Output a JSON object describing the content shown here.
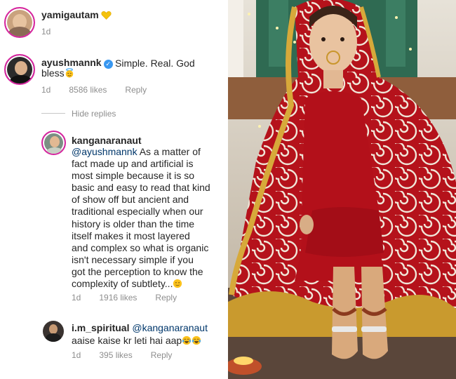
{
  "comments": [
    {
      "username": "yamigautam",
      "text": "",
      "time": "1d",
      "emoji": "yellow-heart"
    },
    {
      "username": "ayushmannk",
      "verified": true,
      "text": "Simple. Real. God",
      "text_line2": "bless",
      "time": "1d",
      "likes": "8586 likes",
      "reply": "Reply",
      "hide_replies": "Hide replies",
      "emoji": "smiling-face-with-halo"
    },
    {
      "username": "kanganaranaut",
      "mention": "@ayushmannk",
      "lines": [
        "As a matter of",
        "fact made up and artificial is",
        "most simple because it is so",
        "basic and easy to read that kind",
        "of show off but ancient and",
        "traditional especially when our",
        "history is older than the time",
        "itself makes it most layered",
        "and complex so what is organic",
        "isn't necessary simple if you",
        "got the perception to know the",
        "complexity of subtlety..."
      ],
      "time": "1d",
      "likes": "1916 likes",
      "reply": "Reply",
      "emoji": "slightly-smiling-face"
    },
    {
      "username": "i.m_spiritual",
      "mention": "@kanganaranaut",
      "text": "aaise kaise kr leti hai aap",
      "time": "1d",
      "likes": "395 likes",
      "reply": "Reply",
      "emoji": "face-with-tears-of-joy"
    }
  ],
  "colors": {
    "mention": "#00376b",
    "meta_gray": "#8e8e8e",
    "story_ring": "#d6249f",
    "saree_red": "#b5121b"
  }
}
